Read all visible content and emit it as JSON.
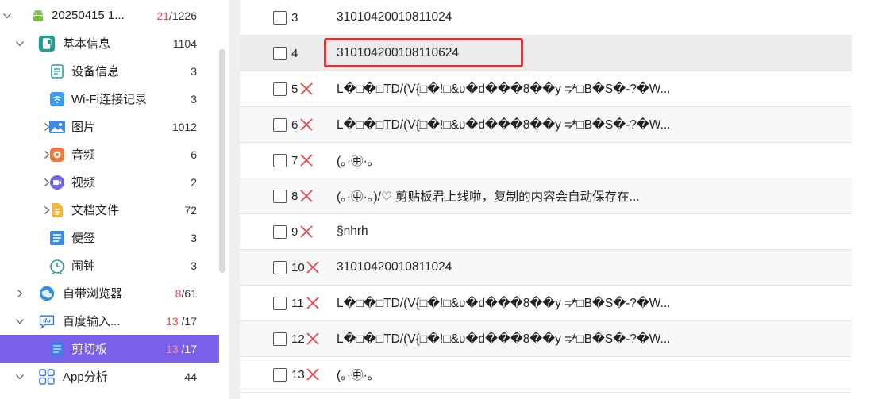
{
  "tree": [
    {
      "label": "20250415 1...",
      "count_red": "21",
      "count_rest": "/1226",
      "icon": "android-icon",
      "chevron": "down",
      "level": 0
    },
    {
      "label": "基本信息",
      "count_red": "",
      "count_rest": "1104",
      "icon": "device-info-group-icon",
      "chevron": "down",
      "level": 1
    },
    {
      "label": "设备信息",
      "count_red": "",
      "count_rest": "3",
      "icon": "device-doc-icon",
      "chevron": "",
      "level": 2
    },
    {
      "label": "Wi-Fi连接记录",
      "count_red": "",
      "count_rest": "3",
      "icon": "wifi-icon",
      "chevron": "",
      "level": 2
    },
    {
      "label": "图片",
      "count_red": "",
      "count_rest": "1012",
      "icon": "image-icon",
      "chevron": "right",
      "level": 2
    },
    {
      "label": "音频",
      "count_red": "",
      "count_rest": "6",
      "icon": "audio-icon",
      "chevron": "right",
      "level": 2
    },
    {
      "label": "视频",
      "count_red": "",
      "count_rest": "2",
      "icon": "video-icon",
      "chevron": "right",
      "level": 2
    },
    {
      "label": "文档文件",
      "count_red": "",
      "count_rest": "72",
      "icon": "document-icon",
      "chevron": "right",
      "level": 2
    },
    {
      "label": "便签",
      "count_red": "",
      "count_rest": "3",
      "icon": "note-icon",
      "chevron": "",
      "level": 2
    },
    {
      "label": "闹钟",
      "count_red": "",
      "count_rest": "3",
      "icon": "alarm-clock-icon",
      "chevron": "",
      "level": 2
    },
    {
      "label": "自带浏览器",
      "count_red": "8",
      "count_rest": "/61",
      "icon": "browser-icon",
      "chevron": "right",
      "level": 1
    },
    {
      "label": "百度输入...",
      "count_red": "13",
      "count_rest": " /17",
      "icon": "baidu-input-icon",
      "chevron": "down",
      "level": 1
    },
    {
      "label": "剪切板",
      "count_red": "13",
      "count_rest": " /17",
      "icon": "clipboard-icon",
      "chevron": "",
      "level": 2,
      "selected": true
    },
    {
      "label": "App分析",
      "count_red": "",
      "count_rest": "44",
      "icon": "app-grid-icon",
      "chevron": "down",
      "level": 1
    }
  ],
  "rows": [
    {
      "num": "3",
      "deleted": false,
      "content": "31010420010811024"
    },
    {
      "num": "4",
      "deleted": false,
      "content": "310104200108110624",
      "highlight": true
    },
    {
      "num": "5",
      "deleted": true,
      "content": "L�□�□TD/(V{□�!□&ʋ�d���8��y =̷*□B�S�-?�W..."
    },
    {
      "num": "6",
      "deleted": true,
      "content": "L�□�□TD/(V{□�!□&ʋ�d���8��y =̷*□B�S�-?�W..."
    },
    {
      "num": "7",
      "deleted": true,
      "content": "(｡·㊥·｡"
    },
    {
      "num": "8",
      "deleted": true,
      "content": "(｡·㊥·｡)/♡  剪贴板君上线啦，复制的内容会自动保存在..."
    },
    {
      "num": "9",
      "deleted": true,
      "content": "§nhrh"
    },
    {
      "num": "10",
      "deleted": true,
      "content": "31010420010811024"
    },
    {
      "num": "11",
      "deleted": true,
      "content": "L�□�□TD/(V{□�!□&ʋ�d���8��y =̷*□B�S�-?�W..."
    },
    {
      "num": "12",
      "deleted": true,
      "content": "L�□�□TD/(V{□�!□&ʋ�d���8��y =̷*□B�S�-?�W..."
    },
    {
      "num": "13",
      "deleted": true,
      "content": "(｡·㊥·｡"
    }
  ],
  "colors": {
    "accent": "#7a5fea",
    "deleted_mark": "#e8474c",
    "highlight_box": "#e03232"
  }
}
